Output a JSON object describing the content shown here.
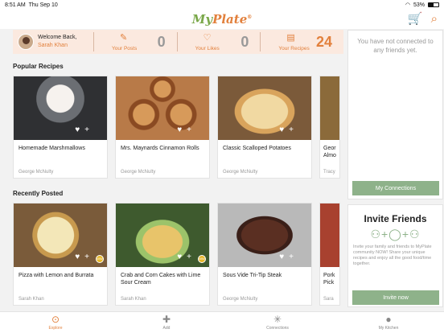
{
  "status": {
    "time": "8:51 AM",
    "date": "Thu Sep 10",
    "battery": "53%"
  },
  "app": {
    "logo_my": "My",
    "logo_plate": "Plate",
    "trademark": "®"
  },
  "header": {
    "cart_icon": "cart-icon",
    "search_icon": "search-icon"
  },
  "profile": {
    "greeting": "Welcome Back,",
    "name": "Sarah Khan"
  },
  "stats": [
    {
      "label": "Your Posts",
      "value": "0",
      "icon": "edit-icon"
    },
    {
      "label": "Your Likes",
      "value": "0",
      "icon": "heart-icon"
    },
    {
      "label": "Your Recipes",
      "value": "24",
      "icon": "recipe-book-icon"
    }
  ],
  "popular": {
    "title": "Popular Recipes",
    "cards": [
      {
        "title": "Homemade Marshmallows",
        "author": "George McNulty"
      },
      {
        "title": "Mrs. Maynards Cinnamon Rolls",
        "author": "George McNulty"
      },
      {
        "title": "Classic Scalloped Potatoes",
        "author": "George McNulty"
      },
      {
        "title": "Geor Almo",
        "author": "Tracy"
      }
    ]
  },
  "recent": {
    "title": "Recently Posted",
    "cards": [
      {
        "title": "Pizza with Lemon and Burrata",
        "author": "Sarah Khan",
        "badge": "WW"
      },
      {
        "title": "Crab and Corn Cakes with Lime Sour Cream",
        "author": "Sarah Khan",
        "badge": "WW"
      },
      {
        "title": "Sous Vide Tri-Tip Steak",
        "author": "George McNulty"
      },
      {
        "title": "Pork Pick",
        "author": "Sara"
      }
    ]
  },
  "connections": {
    "message": "You have not connected to any friends yet.",
    "button": "My Connections"
  },
  "invite": {
    "title": "Invite Friends",
    "body": "Invite your family and friends to MyPlate community NOW! Share your unique recipes and enjoy all the good food/time together.",
    "button": "Invite now"
  },
  "tabs": [
    {
      "label": "Explore",
      "icon": "explore-icon",
      "active": true
    },
    {
      "label": "Add",
      "icon": "plus-icon",
      "active": false
    },
    {
      "label": "Connections",
      "icon": "connections-icon",
      "active": false
    },
    {
      "label": "My Kitchen",
      "icon": "user-icon",
      "active": false
    }
  ],
  "colors": {
    "accent": "#e2803c",
    "green": "#7aa84a",
    "button": "#8eb28a"
  }
}
